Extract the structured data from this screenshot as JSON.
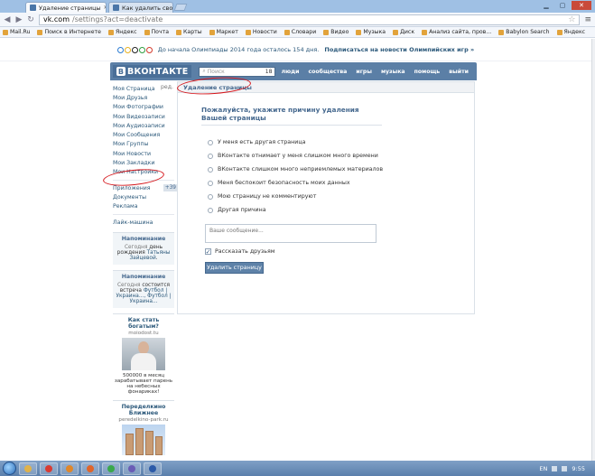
{
  "browser": {
    "tabs": [
      {
        "title": "Удаление страницы",
        "active": true
      },
      {
        "title": "Как удалить свою стра",
        "active": false
      }
    ],
    "url_host": "vk.com",
    "url_path": "/settings?act=deactivate",
    "bookmarks": [
      "Mail.Ru",
      "Поиск в Интернете",
      "Яндекс",
      "Почта",
      "Карты",
      "Маркет",
      "Новости",
      "Словари",
      "Видео",
      "Музыка",
      "Диск",
      "Анализ сайта, пров...",
      "Babylon Search",
      "Яндекс"
    ]
  },
  "promo": {
    "text": "До начала Олимпиады 2014 года осталось 154 дня.",
    "link": "Подписаться на новости Олимпийских игр »",
    "ring_colors": [
      "#2b7bd3",
      "#e8b020",
      "#222222",
      "#2e9e3f",
      "#d33a2c"
    ]
  },
  "vk": {
    "logo": "ВКОНТАКТЕ",
    "logo_letter": "В",
    "search_placeholder": "Поиск",
    "search_count": "18",
    "menu": [
      "люди",
      "сообщества",
      "игры",
      "музыка",
      "помощь",
      "выйти"
    ]
  },
  "sidebar": {
    "edit_label": "ред.",
    "items": [
      {
        "label": "Моя Страница"
      },
      {
        "label": "Мои Друзья"
      },
      {
        "label": "Мои Фотографии"
      },
      {
        "label": "Мои Видеозаписи"
      },
      {
        "label": "Мои Аудиозаписи"
      },
      {
        "label": "Мои Сообщения"
      },
      {
        "label": "Мои Группы"
      },
      {
        "label": "Мои Новости"
      },
      {
        "label": "Мои Закладки"
      },
      {
        "label": "Мои Настройки"
      }
    ],
    "extra_items": [
      {
        "label": "Приложения",
        "badge": "+39"
      },
      {
        "label": "Документы"
      },
      {
        "label": "Реклама"
      }
    ],
    "like_link": "Лайк-машина"
  },
  "reminders": [
    {
      "title": "Напоминание",
      "pre": "Сегодня",
      "mid": " день рождения ",
      "link": "Татьяны Зайцевой",
      "post": "."
    },
    {
      "title": "Напоминание",
      "pre": "Сегодня",
      "mid": " состоится встреча ",
      "link": "Футбол | Украина..., Футбол | Украина...",
      "post": ""
    }
  ],
  "ads": [
    {
      "title": "Как стать богатым?",
      "source": "moiodost.tu",
      "text": "500000 в месяц зарабатывает парень на небесных фонариках!"
    },
    {
      "title": "Переделкино Ближнее",
      "source": "peredelkino-park.ru"
    }
  ],
  "main": {
    "breadcrumb": "Удаление страницы",
    "heading": "Пожалуйста, укажите причину удаления Вашей страницы",
    "reasons": [
      "У меня есть другая страница",
      "ВКонтакте отнимает у меня слишком много времени",
      "ВКонтакте слишком много неприемлемых материалов",
      "Меня беспокоит безопасность моих данных",
      "Мою страницу не комментируют",
      "Другая причина"
    ],
    "message_placeholder": "Ваше сообщение...",
    "tell_friends": "Рассказать друзьям",
    "tell_friends_checked": true,
    "delete_button": "Удалить страницу"
  },
  "taskbar": {
    "apps": [
      "explorer",
      "chrome",
      "opera",
      "firefox",
      "paint",
      "photo",
      "word"
    ],
    "app_colors": [
      "#e0b24a",
      "#d93b32",
      "#e0872a",
      "#e0652a",
      "#3aa84c",
      "#6a5cb5",
      "#2b5aa8"
    ],
    "lang": "EN",
    "time": "9:55"
  },
  "colors": {
    "vk_header": "#5b7fa6",
    "link": "#2b587a",
    "annotation": "#d5161b"
  }
}
